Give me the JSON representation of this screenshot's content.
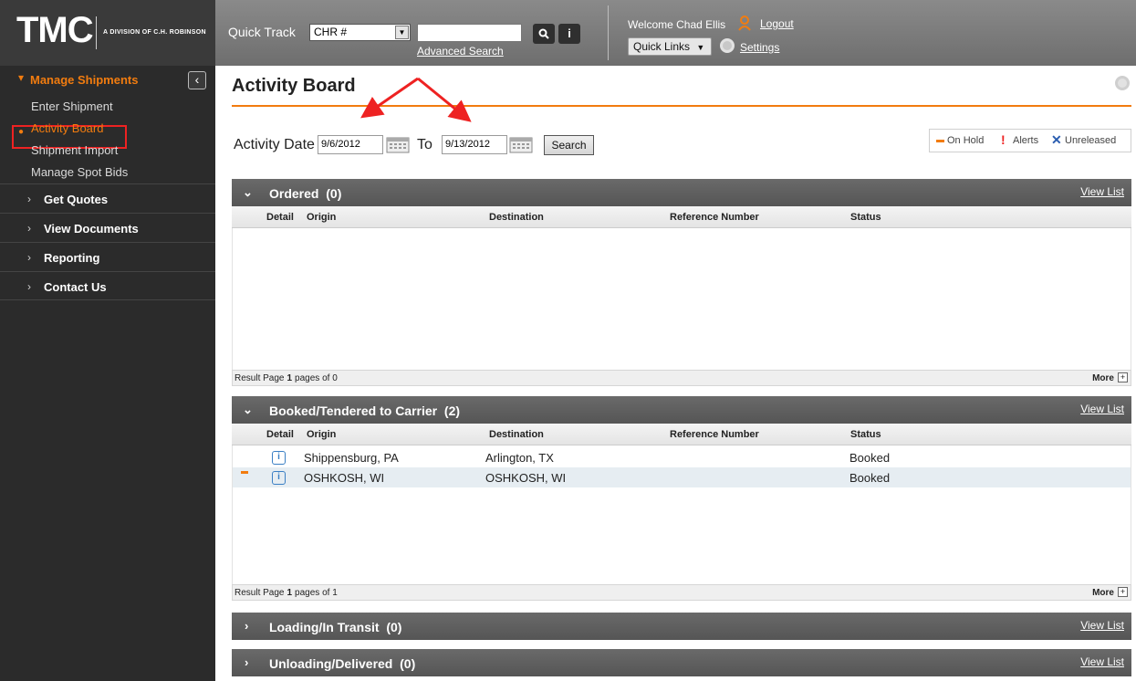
{
  "brand": {
    "logo": "TMC",
    "subtitle": "A DIVISION OF C.H. ROBINSON"
  },
  "topbar": {
    "quick_track_label": "Quick Track",
    "quick_track_select": "CHR #",
    "quick_track_input": "",
    "advanced_search": "Advanced Search",
    "search_icon": "search-icon",
    "info_icon": "info-icon",
    "welcome": "Welcome Chad Ellis",
    "logout": "Logout",
    "quick_links": "Quick Links",
    "settings": "Settings"
  },
  "sidebar": {
    "active_section": "Manage Shipments",
    "sub_items": [
      "Enter Shipment",
      "Activity Board",
      "Shipment Import",
      "Manage Spot Bids"
    ],
    "sections": [
      "Get Quotes",
      "View Documents",
      "Reporting",
      "Contact Us"
    ]
  },
  "page": {
    "title": "Activity Board",
    "activity_date_label": "Activity Date",
    "from_date": "9/6/2012",
    "to_label": "To",
    "to_date": "9/13/2012",
    "search_button": "Search"
  },
  "legend": {
    "on_hold": "On Hold",
    "alerts": "Alerts",
    "unreleased": "Unreleased"
  },
  "columns": {
    "detail": "Detail",
    "origin": "Origin",
    "destination": "Destination",
    "reference": "Reference Number",
    "status": "Status"
  },
  "panels": {
    "ordered": {
      "title": "Ordered",
      "count": "(0)",
      "view_list": "View List",
      "result_page_label": "Result Page",
      "result_page": "1",
      "pages_of": "pages of 0",
      "more": "More"
    },
    "booked": {
      "title": "Booked/Tendered to Carrier",
      "count": "(2)",
      "view_list": "View List",
      "result_page_label": "Result Page",
      "result_page": "1",
      "pages_of": "pages of 1",
      "more": "More",
      "rows": [
        {
          "origin": "Shippensburg, PA",
          "destination": "Arlington, TX",
          "reference": "",
          "status": "Booked",
          "on_hold": false
        },
        {
          "origin": "OSHKOSH, WI",
          "destination": "OSHKOSH, WI",
          "reference": "",
          "status": "Booked",
          "on_hold": true
        }
      ]
    },
    "loading": {
      "title": "Loading/In Transit",
      "count": "(0)",
      "view_list": "View List"
    },
    "unloading": {
      "title": "Unloading/Delivered",
      "count": "(0)",
      "view_list": "View List"
    }
  },
  "colors": {
    "accent": "#f27c0f",
    "sidebar_bg": "#2b2b2b",
    "panel_header": "#5c5c5c",
    "alert": "#e22222",
    "unreleased": "#2a5db0"
  }
}
